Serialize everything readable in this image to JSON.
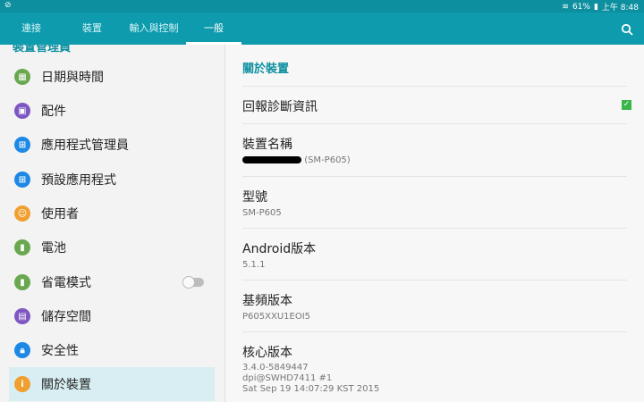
{
  "status": {
    "time": "上午 8:48",
    "battery": "61%"
  },
  "tabs": [
    {
      "label": "連接"
    },
    {
      "label": "裝置"
    },
    {
      "label": "輸入與控制"
    },
    {
      "label": "一般"
    }
  ],
  "left": {
    "header": "裝置管理員",
    "items": [
      {
        "label": "日期與時間",
        "icon": "calendar-icon",
        "color": "#6aa84f"
      },
      {
        "label": "配件",
        "icon": "accessory-icon",
        "color": "#7e57c2"
      },
      {
        "label": "應用程式管理員",
        "icon": "apps-grid-icon",
        "color": "#1e88e5"
      },
      {
        "label": "預設應用程式",
        "icon": "default-apps-icon",
        "color": "#1e88e5"
      },
      {
        "label": "使用者",
        "icon": "user-icon",
        "color": "#f0a030"
      },
      {
        "label": "電池",
        "icon": "battery-icon",
        "color": "#6aa84f"
      },
      {
        "label": "省電模式",
        "icon": "power-saving-icon",
        "color": "#6aa84f"
      },
      {
        "label": "儲存空間",
        "icon": "storage-icon",
        "color": "#7e57c2"
      },
      {
        "label": "安全性",
        "icon": "security-icon",
        "color": "#1e88e5"
      },
      {
        "label": "關於裝置",
        "icon": "info-icon",
        "color": "#f0a030"
      }
    ]
  },
  "right": {
    "section_title": "關於裝置",
    "report_diagnostics": "回報診斷資訊",
    "device_name_title": "裝置名稱",
    "device_name_value": "(SM-P605)",
    "model_title": "型號",
    "model_value": "SM-P605",
    "android_title": "Android版本",
    "android_value": "5.1.1",
    "baseband_title": "基頻版本",
    "baseband_value": "P605XXU1EOI5",
    "kernel_title": "核心版本",
    "kernel_lines": [
      "3.4.0-5849447",
      "dpi@SWHD7411 #1",
      "Sat Sep 19 14:07:29 KST 2015"
    ]
  }
}
